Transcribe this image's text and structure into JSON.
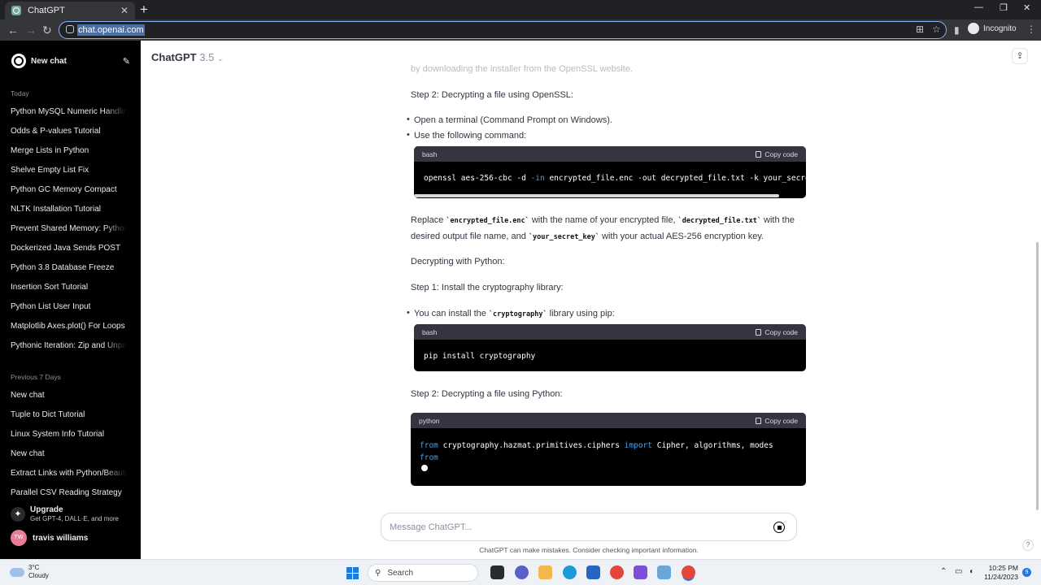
{
  "browser": {
    "tab_title": "ChatGPT",
    "url": "chat.openai.com",
    "profile_label": "Incognito"
  },
  "sidebar": {
    "new_chat": "New chat",
    "sections": [
      {
        "label": "Today",
        "items": [
          "Python MySQL Numeric Handling",
          "Odds & P-values Tutorial",
          "Merge Lists in Python",
          "Shelve Empty List Fix",
          "Python GC Memory Compact",
          "NLTK Installation Tutorial",
          "Prevent Shared Memory: Python",
          "Dockerized Java Sends POST",
          "Python 3.8 Database Freeze",
          "Insertion Sort Tutorial",
          "Python List User Input",
          "Matplotlib Axes.plot() For Loops",
          "Pythonic Iteration: Zip and Unpack"
        ]
      },
      {
        "label": "Previous 7 Days",
        "items": [
          "New chat",
          "Tuple to Dict Tutorial",
          "Linux System Info Tutorial",
          "New chat",
          "Extract Links with Python/Beautiful",
          "Parallel CSV Reading Strategy"
        ]
      }
    ],
    "upgrade_title": "Upgrade",
    "upgrade_sub": "Get GPT-4, DALL·E, and more",
    "user_initials": "TW",
    "user_name": "travis williams"
  },
  "header": {
    "model_name": "ChatGPT",
    "model_version": "3.5"
  },
  "content": {
    "faded_line": "by downloading the installer from the OpenSSL website.",
    "step2_openssl": "Step 2: Decrypting a file using OpenSSL:",
    "bullet_terminal": "Open a terminal (Command Prompt on Windows).",
    "bullet_command": "Use the following command:",
    "code1_lang": "bash",
    "copy_label": "Copy code",
    "code1_pre": "openssl aes-256-cbc -d ",
    "code1_flag": "-in",
    "code1_post": " encrypted_file.enc -out decrypted_file.txt -k your_secret_key",
    "replace_1": "Replace ",
    "replace_code1": "`encrypted_file.enc`",
    "replace_2": " with the name of your encrypted file, ",
    "replace_code2": "`decrypted_file.txt`",
    "replace_3": " with the desired output file name, and ",
    "replace_code3": "`your_secret_key`",
    "replace_4": " with your actual AES-256 encryption key.",
    "decrypting_python": "Decrypting with Python:",
    "step1_install": "Step 1: Install the cryptography library:",
    "bullet_pip_1": "You can install the ",
    "bullet_pip_code": "`cryptography`",
    "bullet_pip_2": " library using pip:",
    "code2_lang": "bash",
    "code2_text": "pip install cryptography",
    "step2_python": "Step 2: Decrypting a file using Python:",
    "code3_lang": "python",
    "code3_kw1": "from",
    "code3_mid": " cryptography.hazmat.primitives.ciphers ",
    "code3_kw2": "import",
    "code3_tail": " Cipher, algorithms, modes",
    "code3_line2": "from"
  },
  "composer": {
    "placeholder": "Message ChatGPT...",
    "disclaimer": "ChatGPT can make mistakes. Consider checking important information."
  },
  "taskbar": {
    "temperature": "3°C",
    "condition": "Cloudy",
    "search_label": "Search",
    "time": "10:25 PM",
    "date": "11/24/2023",
    "notification_count": "9"
  }
}
